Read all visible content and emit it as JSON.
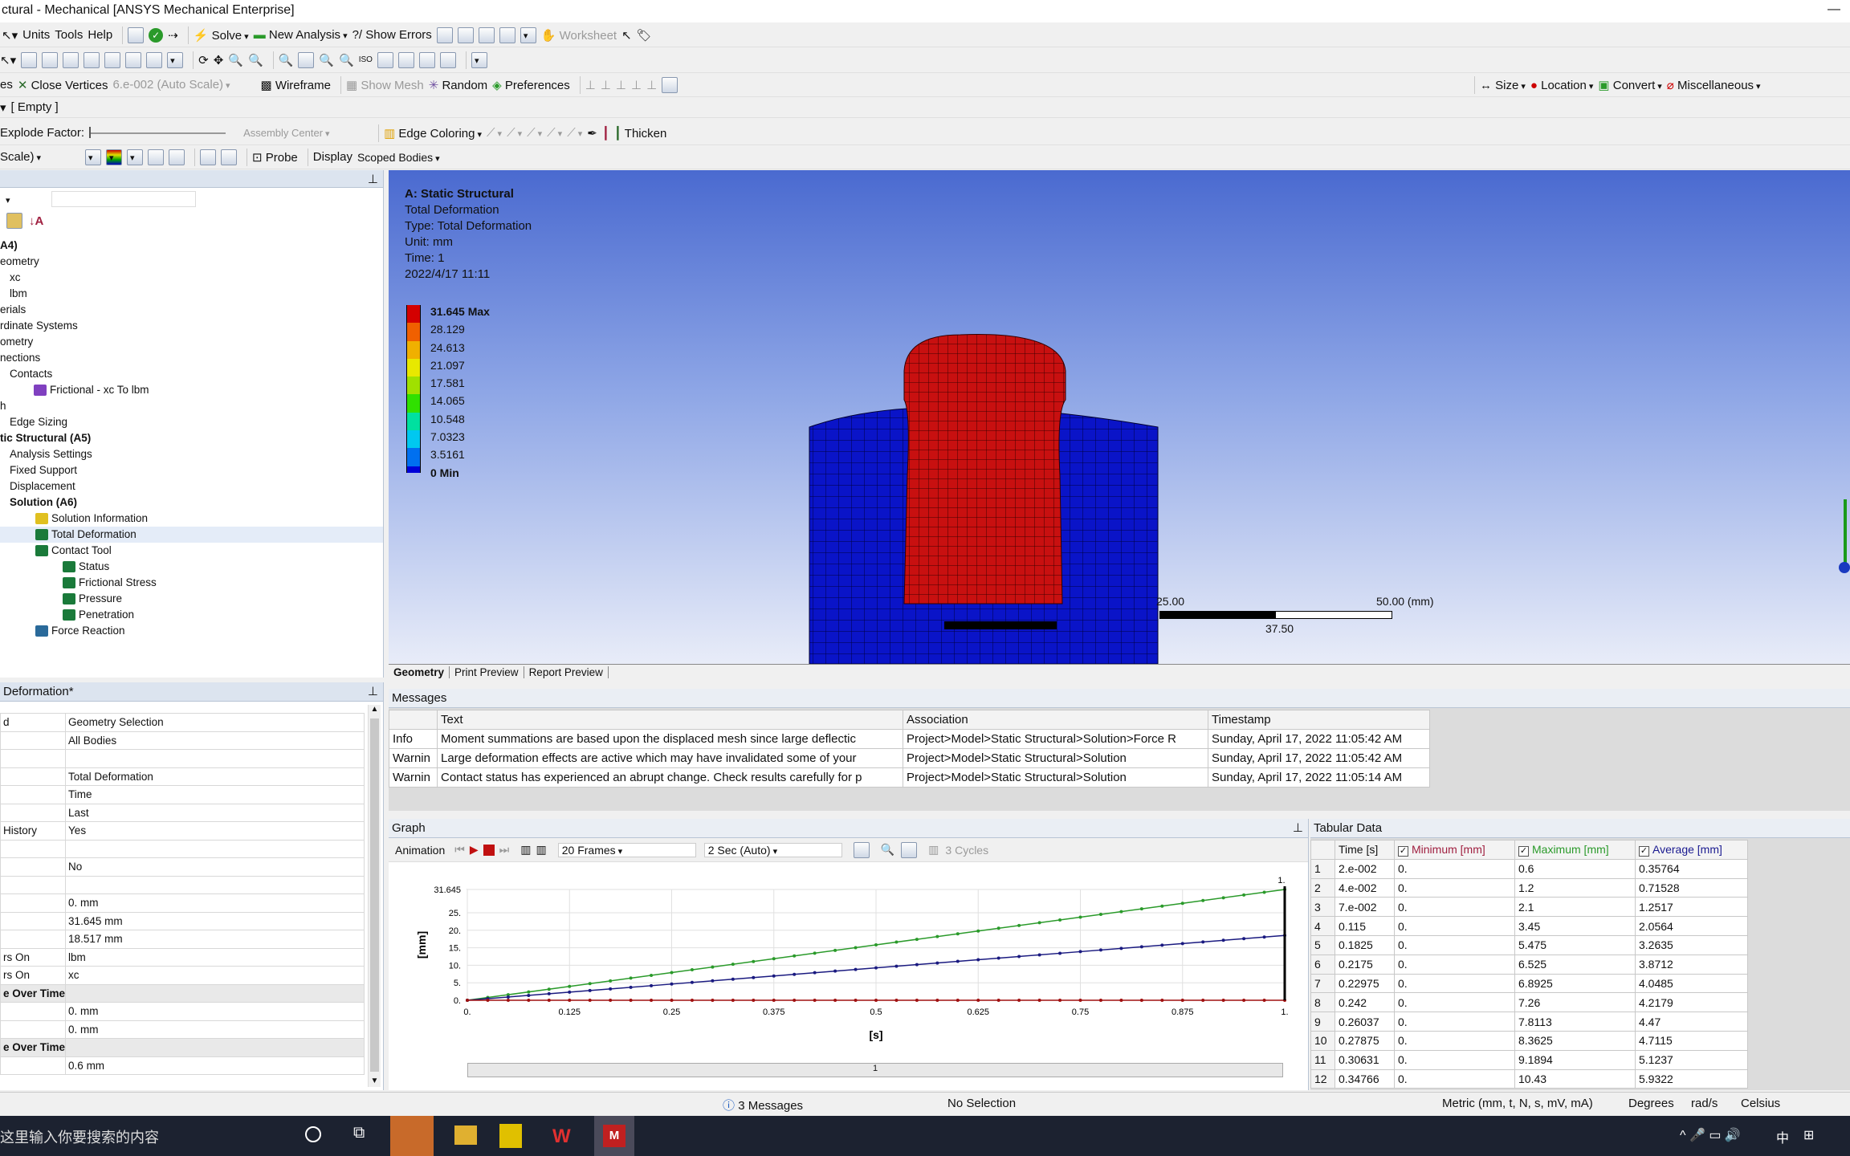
{
  "title": "ctural - Mechanical [ANSYS Mechanical Enterprise]",
  "menu": [
    "Units",
    "Tools",
    "Help"
  ],
  "toolbar1": {
    "solve": "Solve",
    "new_analysis": "New Analysis",
    "show_errors": "Show Errors",
    "worksheet": "Worksheet"
  },
  "toolbar2": {
    "es": "es",
    "close_vertices": "Close Vertices",
    "scale_value": "6.e-002 (Auto Scale)",
    "wireframe": "Wireframe",
    "show_mesh": "Show Mesh",
    "random": "Random",
    "preferences": "Preferences",
    "size": "Size",
    "location": "Location",
    "convert": "Convert",
    "misc": "Miscellaneous"
  },
  "toolbar3": {
    "empty": "[ Empty ]"
  },
  "toolbar4": {
    "explode": "Explode Factor:",
    "assembly_center": "Assembly Center",
    "edge_coloring": "Edge Coloring",
    "thicken": "Thicken"
  },
  "toolbar5": {
    "scale": "Scale)",
    "probe": "Probe",
    "display": "Display",
    "scoped": "Scoped Bodies"
  },
  "tree": [
    {
      "label": "A4)",
      "indent": 0,
      "bold": true,
      "icon": ""
    },
    {
      "label": "eometry",
      "indent": 0,
      "icon": ""
    },
    {
      "label": "xc",
      "indent": 12,
      "icon": ""
    },
    {
      "label": "lbm",
      "indent": 12,
      "icon": ""
    },
    {
      "label": "erials",
      "indent": 0,
      "icon": ""
    },
    {
      "label": "rdinate Systems",
      "indent": 0,
      "icon": ""
    },
    {
      "label": "ometry",
      "indent": 0,
      "icon": ""
    },
    {
      "label": "nections",
      "indent": 0,
      "icon": ""
    },
    {
      "label": "Contacts",
      "indent": 12,
      "icon": ""
    },
    {
      "label": "Frictional - xc To lbm",
      "indent": 42,
      "icon": "contact"
    },
    {
      "label": "h",
      "indent": 0,
      "icon": ""
    },
    {
      "label": "Edge Sizing",
      "indent": 12,
      "icon": ""
    },
    {
      "label": "tic Structural (A5)",
      "indent": 0,
      "bold": true,
      "icon": ""
    },
    {
      "label": "Analysis Settings",
      "indent": 12,
      "icon": ""
    },
    {
      "label": "Fixed Support",
      "indent": 12,
      "icon": ""
    },
    {
      "label": "Displacement",
      "indent": 12,
      "icon": ""
    },
    {
      "label": "Solution (A6)",
      "indent": 12,
      "bold": true,
      "icon": ""
    },
    {
      "label": "Solution Information",
      "indent": 44,
      "icon": "info"
    },
    {
      "label": "Total Deformation",
      "indent": 44,
      "icon": "result",
      "selected": true
    },
    {
      "label": "Contact Tool",
      "indent": 44,
      "icon": "tool"
    },
    {
      "label": "Status",
      "indent": 78,
      "icon": "result"
    },
    {
      "label": "Frictional Stress",
      "indent": 78,
      "icon": "result"
    },
    {
      "label": "Pressure",
      "indent": 78,
      "icon": "result"
    },
    {
      "label": "Penetration",
      "indent": 78,
      "icon": "result"
    },
    {
      "label": "Force Reaction",
      "indent": 44,
      "icon": "probe"
    }
  ],
  "details": {
    "title": "Deformation*",
    "rows": [
      [
        "d",
        "Geometry Selection"
      ],
      [
        "",
        "All Bodies"
      ],
      [
        "",
        ""
      ],
      [
        "",
        "Total Deformation"
      ],
      [
        "",
        "Time"
      ],
      [
        "",
        "Last"
      ],
      [
        "History",
        "Yes"
      ],
      [
        "",
        ""
      ],
      [
        "",
        "No"
      ],
      [
        "",
        ""
      ],
      [
        "",
        "0. mm"
      ],
      [
        "",
        "31.645 mm"
      ],
      [
        "",
        "18.517 mm"
      ],
      [
        "rs On",
        "lbm"
      ],
      [
        "rs On",
        "xc"
      ],
      [
        "e Over Time",
        ""
      ],
      [
        "",
        "0. mm"
      ],
      [
        "",
        "0. mm"
      ],
      [
        "e Over Time",
        ""
      ],
      [
        "",
        "0.6 mm"
      ]
    ],
    "groups": [
      15,
      18
    ]
  },
  "viewport": {
    "info": [
      "A: Static Structural",
      "Total Deformation",
      "Type: Total Deformation",
      "Unit: mm",
      "Time: 1",
      "2022/4/17 11:11"
    ],
    "legend": [
      "31.645 Max",
      "28.129",
      "24.613",
      "21.097",
      "17.581",
      "14.065",
      "10.548",
      "7.0323",
      "3.5161",
      "0 Min"
    ],
    "legend_colors": [
      "#d40000",
      "#f06000",
      "#f0b000",
      "#e8e800",
      "#a0e000",
      "#30e000",
      "#00e0a0",
      "#00c8f0",
      "#0070f0",
      "#0000d8"
    ],
    "scale_labels": [
      "25.00",
      "50.00 (mm)",
      "37.50"
    ],
    "tabs": [
      "Geometry",
      "Print Preview",
      "Report Preview"
    ]
  },
  "messages": {
    "title": "Messages",
    "headers": [
      "",
      "Text",
      "Association",
      "Timestamp"
    ],
    "rows": [
      [
        "Info",
        "Moment summations are based upon the displaced mesh since large deflectic",
        "Project>Model>Static Structural>Solution>Force R",
        "Sunday, April 17, 2022 11:05:42 AM"
      ],
      [
        "Warnin",
        "Large deformation effects are active which may have invalidated some of your",
        "Project>Model>Static Structural>Solution",
        "Sunday, April 17, 2022 11:05:42 AM"
      ],
      [
        "Warnin",
        "Contact status has experienced an abrupt change.  Check results carefully for p",
        "Project>Model>Static Structural>Solution",
        "Sunday, April 17, 2022 11:05:14 AM"
      ]
    ]
  },
  "graph": {
    "title": "Graph",
    "animation": "Animation",
    "frames": "20 Frames",
    "duration": "2 Sec (Auto)",
    "cycles": "3 Cycles",
    "xlabel": "[s]",
    "ylabel": "[mm]",
    "scroll_label": "1",
    "top_label": "1."
  },
  "chart_data": {
    "type": "line",
    "x": [
      0.0,
      0.125,
      0.25,
      0.375,
      0.5,
      0.625,
      0.75,
      0.875,
      1.0
    ],
    "x_ticks": [
      "0.",
      "0.125",
      "0.25",
      "0.375",
      "0.5",
      "0.625",
      "0.75",
      "0.875",
      "1."
    ],
    "y_ticks": [
      "0.",
      "5.",
      "10.",
      "15.",
      "20.",
      "25.",
      "31.645"
    ],
    "ylim": [
      0,
      31.645
    ],
    "xlim": [
      0,
      1
    ],
    "series": [
      {
        "color": "#2a9a2a",
        "values": [
          0,
          3.956,
          7.911,
          11.867,
          15.823,
          19.778,
          23.734,
          27.689,
          31.645
        ]
      },
      {
        "color": "#1a1a80",
        "values": [
          0,
          2.315,
          4.629,
          6.944,
          9.259,
          11.573,
          13.888,
          16.202,
          18.517
        ]
      },
      {
        "color": "#a01010",
        "values": [
          0,
          0,
          0,
          0,
          0,
          0,
          0,
          0,
          0
        ]
      }
    ]
  },
  "tabular": {
    "title": "Tabular Data",
    "headers": [
      "",
      "Time [s]",
      "Minimum [mm]",
      "Maximum [mm]",
      "Average [mm]"
    ],
    "rows": [
      [
        "1",
        "2.e-002",
        "0.",
        "0.6",
        "0.35764"
      ],
      [
        "2",
        "4.e-002",
        "0.",
        "1.2",
        "0.71528"
      ],
      [
        "3",
        "7.e-002",
        "0.",
        "2.1",
        "1.2517"
      ],
      [
        "4",
        "0.115",
        "0.",
        "3.45",
        "2.0564"
      ],
      [
        "5",
        "0.1825",
        "0.",
        "5.475",
        "3.2635"
      ],
      [
        "6",
        "0.2175",
        "0.",
        "6.525",
        "3.8712"
      ],
      [
        "7",
        "0.22975",
        "0.",
        "6.8925",
        "4.0485"
      ],
      [
        "8",
        "0.242",
        "0.",
        "7.26",
        "4.2179"
      ],
      [
        "9",
        "0.26037",
        "0.",
        "7.8113",
        "4.47"
      ],
      [
        "10",
        "0.27875",
        "0.",
        "8.3625",
        "4.7115"
      ],
      [
        "11",
        "0.30631",
        "0.",
        "9.1894",
        "5.1237"
      ],
      [
        "12",
        "0.34766",
        "0.",
        "10.43",
        "5.9322"
      ]
    ]
  },
  "status": {
    "messages": "3 Messages",
    "selection": "No Selection",
    "units": "Metric (mm, t, N, s, mV, mA)",
    "degrees": "Degrees",
    "rads": "rad/s",
    "temp": "Celsius"
  },
  "taskbar": {
    "search": "这里输入你要搜索的内容",
    "ime": "中"
  }
}
